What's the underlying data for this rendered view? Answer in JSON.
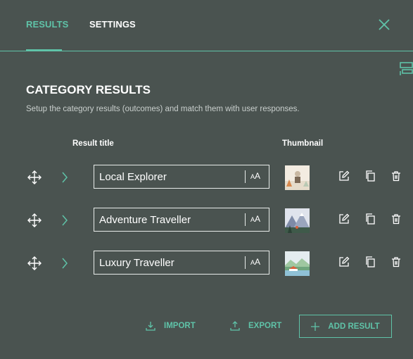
{
  "tabs": {
    "results": "RESULTS",
    "settings": "SETTINGS"
  },
  "colors": {
    "background": "#4a5350",
    "accent": "#5fc3a8",
    "text": "#ffffff"
  },
  "section": {
    "title": "CATEGORY RESULTS",
    "subtitle": "Setup the category results (outcomes) and match them with user responses."
  },
  "columns": {
    "result_title": "Result title",
    "thumbnail": "Thumbnail"
  },
  "results": [
    {
      "title": "Local Explorer"
    },
    {
      "title": "Adventure Traveller"
    },
    {
      "title": "Luxury Traveller"
    }
  ],
  "text_size_toggle": "AA",
  "footer": {
    "import": "IMPORT",
    "export": "EXPORT",
    "add_result": "ADD RESULT"
  },
  "icons": [
    "close-icon",
    "layout-icon",
    "move-icon",
    "chevron-right-icon",
    "text-size-icon",
    "edit-icon",
    "duplicate-icon",
    "delete-icon",
    "download-icon",
    "upload-icon",
    "plus-icon"
  ]
}
